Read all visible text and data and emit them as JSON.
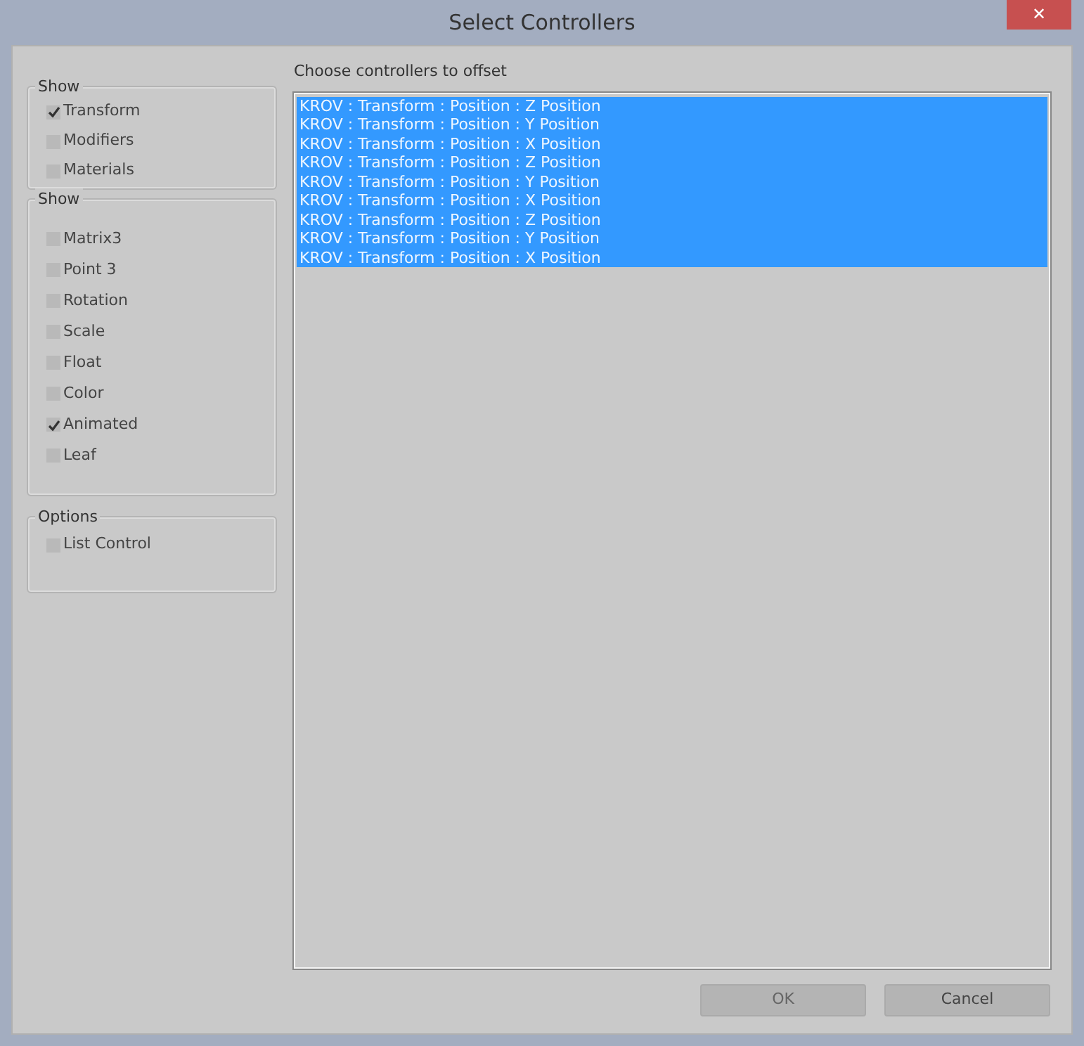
{
  "window": {
    "title": "Select Controllers",
    "close": "✕"
  },
  "groups": [
    {
      "title": "Show",
      "items": [
        {
          "label": "Transform",
          "checked": true
        },
        {
          "label": "Modifiers",
          "checked": false
        },
        {
          "label": "Materials",
          "checked": false
        }
      ]
    },
    {
      "title": "Show",
      "items": [
        {
          "label": "Matrix3",
          "checked": false
        },
        {
          "label": "Point 3",
          "checked": false
        },
        {
          "label": "Rotation",
          "checked": false
        },
        {
          "label": "Scale",
          "checked": false
        },
        {
          "label": "Float",
          "checked": false
        },
        {
          "label": "Color",
          "checked": false
        },
        {
          "label": "Animated",
          "checked": true
        },
        {
          "label": "Leaf",
          "checked": false
        }
      ]
    },
    {
      "title": "Options",
      "items": [
        {
          "label": "List Control",
          "checked": false
        }
      ]
    }
  ],
  "list": {
    "label": "Choose controllers to offset",
    "rows": [
      {
        "text": "KROV : Transform : Position : Z Position",
        "selected": true
      },
      {
        "text": "KROV : Transform : Position : Y Position",
        "selected": true
      },
      {
        "text": "KROV : Transform : Position : X Position",
        "selected": true
      },
      {
        "text": "KROV : Transform : Position : Z Position",
        "selected": true
      },
      {
        "text": "KROV : Transform : Position : Y Position",
        "selected": true
      },
      {
        "text": "KROV : Transform : Position : X Position",
        "selected": true
      },
      {
        "text": "KROV : Transform : Position : Z Position",
        "selected": true
      },
      {
        "text": "KROV : Transform : Position : Y Position",
        "selected": true
      },
      {
        "text": "KROV : Transform : Position : X Position",
        "selected": true
      }
    ]
  },
  "buttons": [
    {
      "label": "OK",
      "disabled": true
    },
    {
      "label": "Cancel",
      "disabled": false
    }
  ]
}
